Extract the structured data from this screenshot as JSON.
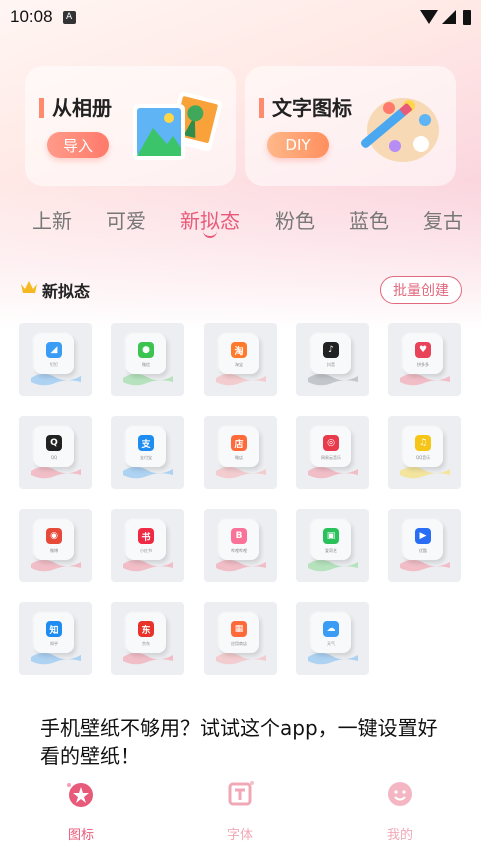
{
  "status_bar": {
    "time": "10:08",
    "notification_badge": "A"
  },
  "hero_cards": [
    {
      "title": "从相册",
      "button": "导入"
    },
    {
      "title": "文字图标",
      "button": "DIY"
    }
  ],
  "tabs": [
    {
      "label": "上新",
      "active": false
    },
    {
      "label": "可爱",
      "active": false
    },
    {
      "label": "新拟态",
      "active": true
    },
    {
      "label": "粉色",
      "active": false
    },
    {
      "label": "蓝色",
      "active": false
    },
    {
      "label": "复古",
      "active": false
    }
  ],
  "section": {
    "title": "新拟态",
    "batch_button": "批量创建"
  },
  "icons": [
    {
      "name": "钉钉",
      "glyph": "◢",
      "color": "#3b9cf5",
      "wave": "#9ecbf3"
    },
    {
      "name": "微信",
      "glyph": "●",
      "color": "#3cc450",
      "wave": "#a9dfb0"
    },
    {
      "name": "淘宝",
      "glyph": "淘",
      "color": "#ff7a2a",
      "wave": "#f5c3c7"
    },
    {
      "name": "抖音",
      "glyph": "♪",
      "color": "#222222",
      "wave": "#b9bcc0"
    },
    {
      "name": "拼多多",
      "glyph": "♥",
      "color": "#e9435a",
      "wave": "#f3b2bd"
    },
    {
      "name": "QQ",
      "glyph": "Q",
      "color": "#222222",
      "wave": "#f3b2bd"
    },
    {
      "name": "支付宝",
      "glyph": "支",
      "color": "#1e8cf0",
      "wave": "#9ecbf3"
    },
    {
      "name": "微店",
      "glyph": "店",
      "color": "#ff6a3a",
      "wave": "#f5c3c7"
    },
    {
      "name": "网易云音乐",
      "glyph": "◎",
      "color": "#e83c4c",
      "wave": "#f3b2bd"
    },
    {
      "name": "QQ音乐",
      "glyph": "♫",
      "color": "#f5c518",
      "wave": "#f5e28a"
    },
    {
      "name": "微博",
      "glyph": "◉",
      "color": "#e84a3a",
      "wave": "#f3b2bd"
    },
    {
      "name": "小红书",
      "glyph": "书",
      "color": "#ee2a44",
      "wave": "#f3b2bd"
    },
    {
      "name": "哔哩哔哩",
      "glyph": "B",
      "color": "#fb7299",
      "wave": "#f3b2bd"
    },
    {
      "name": "爱奇艺",
      "glyph": "▣",
      "color": "#2ac05a",
      "wave": "#a9dfb0"
    },
    {
      "name": "优酷",
      "glyph": "▶",
      "color": "#2a6df5",
      "wave": "#f3b2bd"
    },
    {
      "name": "知乎",
      "glyph": "知",
      "color": "#1e8cf0",
      "wave": "#9ecbf3"
    },
    {
      "name": "京东",
      "glyph": "东",
      "color": "#e8322a",
      "wave": "#f3b2bd"
    },
    {
      "name": "应用商店",
      "glyph": "▦",
      "color": "#ff6a3a",
      "wave": "#f5c3c7"
    },
    {
      "name": "天气",
      "glyph": "☁",
      "color": "#3b9cf5",
      "wave": "#9ecbf3"
    }
  ],
  "promo_text": "手机壁纸不够用？试试这个app，一键设置好看的壁纸！",
  "bottom_nav": [
    {
      "label": "图标",
      "active": true
    },
    {
      "label": "字体",
      "active": false
    },
    {
      "label": "我的",
      "active": false
    }
  ],
  "colors": {
    "accent": "#e85a7a",
    "button_orange": "#ff7a6a"
  }
}
